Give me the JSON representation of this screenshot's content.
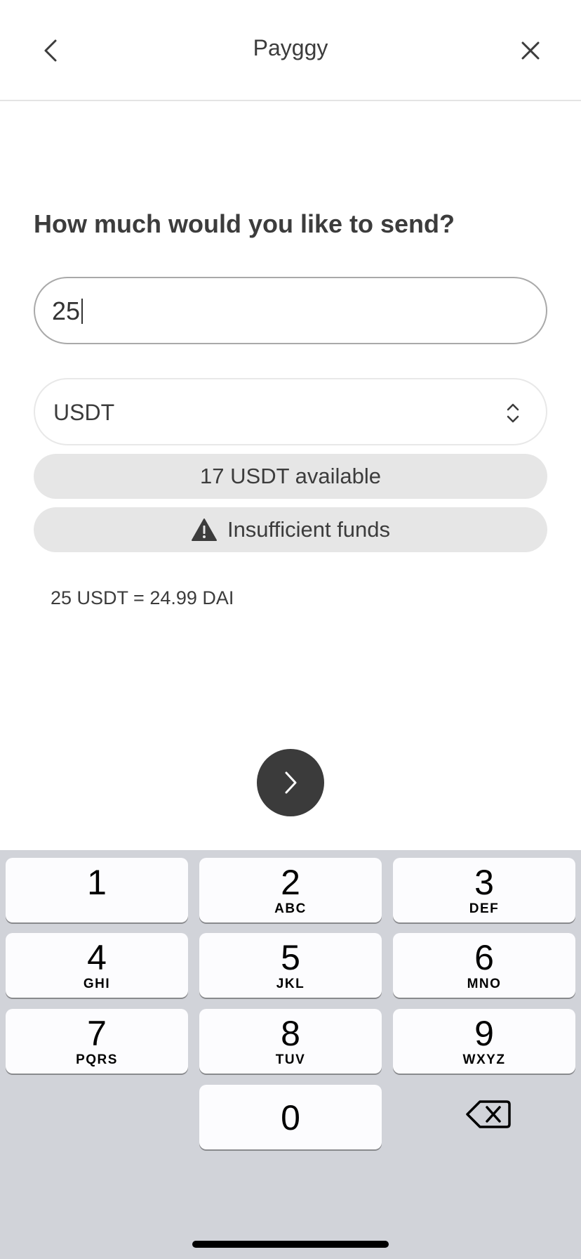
{
  "header": {
    "title": "Payggy",
    "back_icon": "chevron-left-icon",
    "close_icon": "close-icon"
  },
  "form": {
    "question": "How much would you like to send?",
    "amount_value": "25",
    "currency_selected": "USDT",
    "available_text": "17 USDT available",
    "warning_text": "Insufficient funds",
    "conversion_text": "25 USDT = 24.99 DAI"
  },
  "keyboard": {
    "keys": [
      {
        "num": "1",
        "letters": ""
      },
      {
        "num": "2",
        "letters": "ABC"
      },
      {
        "num": "3",
        "letters": "DEF"
      },
      {
        "num": "4",
        "letters": "GHI"
      },
      {
        "num": "5",
        "letters": "JKL"
      },
      {
        "num": "6",
        "letters": "MNO"
      },
      {
        "num": "7",
        "letters": "PQRS"
      },
      {
        "num": "8",
        "letters": "TUV"
      },
      {
        "num": "9",
        "letters": "WXYZ"
      },
      {
        "num": "0",
        "letters": ""
      }
    ],
    "backspace_icon": "backspace-icon"
  },
  "colors": {
    "primary_button": "#3b3b3b",
    "keyboard_bg": "#d1d3d9",
    "pill_bg": "#e6e6e6"
  }
}
